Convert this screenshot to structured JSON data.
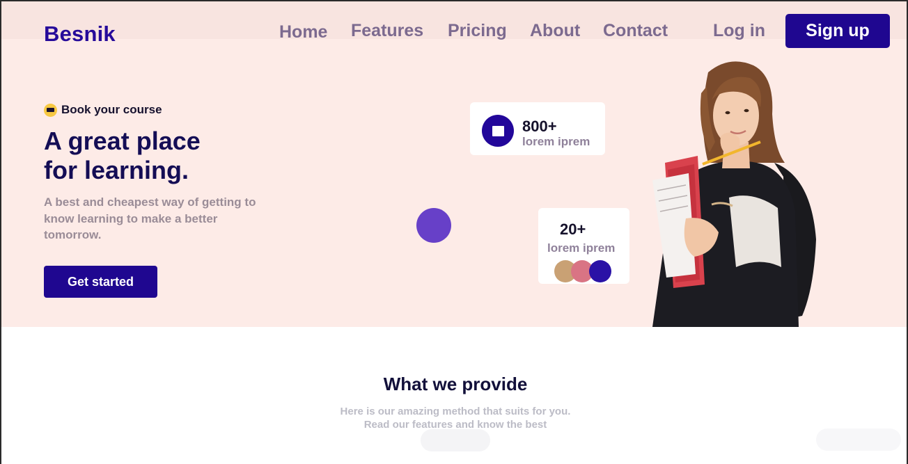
{
  "brand": {
    "name": "Besnik"
  },
  "nav": {
    "items": [
      "Home",
      "Features",
      "Pricing",
      "About",
      "Contact"
    ],
    "login_label": "Log in",
    "signup_label": "Sign up"
  },
  "hero": {
    "badge": "Book your course",
    "headline_line1": "A great place",
    "headline_line2": "for learning.",
    "subtext": "A best and cheapest way of getting to know learning to make a better tomorrow.",
    "cta_label": "Get started",
    "stat_card_1": {
      "value": "800+",
      "label": "lorem iprem"
    },
    "stat_card_2": {
      "value": "20+",
      "label": "lorem iprem"
    }
  },
  "provide": {
    "title": "What we provide",
    "subtitle_line1": "Here is our amazing method that suits for you.",
    "subtitle_line2": "Read our features and know the best"
  },
  "colors": {
    "brand": "#260a9a",
    "primary_button": "#1f0790",
    "hero_background": "#fdebe7",
    "accent_dot": "#6740c8",
    "badge_yellow": "#f7c843"
  },
  "icons": {
    "badge": "card-icon",
    "stat_card_1": "square-icon"
  }
}
